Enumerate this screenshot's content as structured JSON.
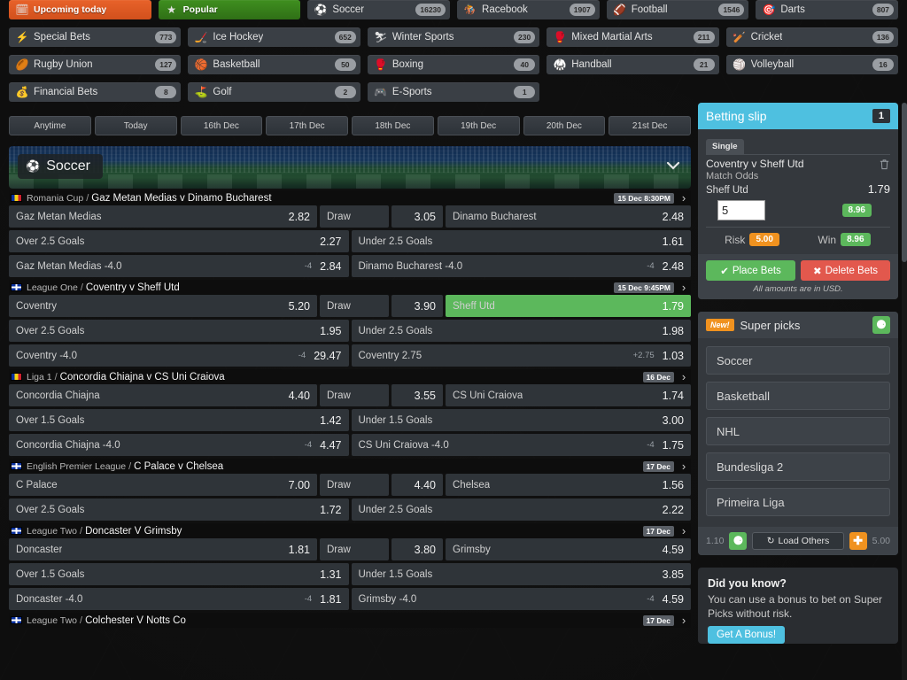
{
  "nav": {
    "tabs": [
      {
        "label": "Upcoming today",
        "icon": "calendar-icon",
        "style": "upcoming"
      },
      {
        "label": "Popular",
        "icon": "star-icon",
        "style": "popular"
      }
    ],
    "sports": [
      {
        "label": "Soccer",
        "count": "16230",
        "icon": "soccer-ball-icon"
      },
      {
        "label": "Racebook",
        "count": "1907",
        "icon": "horse-racing-icon"
      },
      {
        "label": "Football",
        "count": "1546",
        "icon": "american-football-icon"
      },
      {
        "label": "Darts",
        "count": "807",
        "icon": "dart-icon"
      },
      {
        "label": "Special Bets",
        "count": "773",
        "icon": "lightning-icon"
      },
      {
        "label": "Ice Hockey",
        "count": "652",
        "icon": "hockey-puck-icon"
      },
      {
        "label": "Winter Sports",
        "count": "230",
        "icon": "skier-icon"
      },
      {
        "label": "Mixed Martial Arts",
        "count": "211",
        "icon": "mma-glove-icon"
      },
      {
        "label": "Cricket",
        "count": "136",
        "icon": "cricket-bat-icon"
      },
      {
        "label": "Rugby Union",
        "count": "127",
        "icon": "rugby-ball-icon"
      },
      {
        "label": "Basketball",
        "count": "50",
        "icon": "basketball-icon"
      },
      {
        "label": "Boxing",
        "count": "40",
        "icon": "boxing-glove-icon"
      },
      {
        "label": "Handball",
        "count": "21",
        "icon": "handball-icon"
      },
      {
        "label": "Volleyball",
        "count": "16",
        "icon": "volleyball-icon"
      },
      {
        "label": "Financial Bets",
        "count": "8",
        "icon": "money-icon"
      },
      {
        "label": "Golf",
        "count": "2",
        "icon": "golf-icon"
      },
      {
        "label": "E-Sports",
        "count": "1",
        "icon": "gamepad-icon"
      }
    ]
  },
  "date_tabs": [
    "Anytime",
    "Today",
    "16th Dec",
    "17th Dec",
    "18th Dec",
    "19th Dec",
    "20th Dec",
    "21st Dec"
  ],
  "banner": {
    "sport": "Soccer",
    "icon": "soccer-ball-icon",
    "collapse_icon": "chevron-down-icon"
  },
  "matches": [
    {
      "flag": "ro",
      "league": "Romania Cup",
      "title": "Gaz Metan Medias v Dinamo Bucharest",
      "date": "15 Dec 8:30PM",
      "rows": [
        {
          "type": "3way",
          "cells": [
            {
              "name": "Gaz Metan Medias",
              "odds": "2.82"
            },
            {
              "name": "Draw",
              "odds": "3.05"
            },
            {
              "name": "Dinamo Bucharest",
              "odds": "2.48"
            }
          ]
        },
        {
          "type": "2way",
          "cells": [
            {
              "name": "Over 2.5 Goals",
              "odds": "2.27"
            },
            {
              "name": "Under 2.5 Goals",
              "odds": "1.61"
            }
          ]
        },
        {
          "type": "2way",
          "cells": [
            {
              "name": "Gaz Metan Medias -4.0",
              "hcap": "-4",
              "odds": "2.84"
            },
            {
              "name": "Dinamo Bucharest -4.0",
              "hcap": "-4",
              "odds": "2.48"
            }
          ]
        }
      ]
    },
    {
      "flag": "gb",
      "league": "League One",
      "title": "Coventry v Sheff Utd",
      "date": "15 Dec 9:45PM",
      "rows": [
        {
          "type": "3way",
          "cells": [
            {
              "name": "Coventry",
              "odds": "5.20"
            },
            {
              "name": "Draw",
              "odds": "3.90"
            },
            {
              "name": "Sheff Utd",
              "odds": "1.79",
              "selected": true
            }
          ]
        },
        {
          "type": "2way",
          "cells": [
            {
              "name": "Over 2.5 Goals",
              "odds": "1.95"
            },
            {
              "name": "Under 2.5 Goals",
              "odds": "1.98"
            }
          ]
        },
        {
          "type": "2way",
          "cells": [
            {
              "name": "Coventry -4.0",
              "hcap": "-4",
              "odds": "29.47"
            },
            {
              "name": "Coventry 2.75",
              "hcap": "+2.75",
              "odds": "1.03"
            }
          ]
        }
      ]
    },
    {
      "flag": "ro",
      "league": "Liga 1",
      "title": "Concordia Chiajna v CS Uni Craiova",
      "date": "16 Dec",
      "rows": [
        {
          "type": "3way",
          "cells": [
            {
              "name": "Concordia Chiajna",
              "odds": "4.40"
            },
            {
              "name": "Draw",
              "odds": "3.55"
            },
            {
              "name": "CS Uni Craiova",
              "odds": "1.74"
            }
          ]
        },
        {
          "type": "2way",
          "cells": [
            {
              "name": "Over 1.5 Goals",
              "odds": "1.42"
            },
            {
              "name": "Under 1.5 Goals",
              "odds": "3.00"
            }
          ]
        },
        {
          "type": "2way",
          "cells": [
            {
              "name": "Concordia Chiajna -4.0",
              "hcap": "-4",
              "odds": "4.47"
            },
            {
              "name": "CS Uni Craiova -4.0",
              "hcap": "-4",
              "odds": "1.75"
            }
          ]
        }
      ]
    },
    {
      "flag": "gb",
      "league": "English Premier League",
      "title": "C Palace v Chelsea",
      "date": "17 Dec",
      "rows": [
        {
          "type": "3way",
          "cells": [
            {
              "name": "C Palace",
              "odds": "7.00"
            },
            {
              "name": "Draw",
              "odds": "4.40"
            },
            {
              "name": "Chelsea",
              "odds": "1.56"
            }
          ]
        },
        {
          "type": "2way",
          "cells": [
            {
              "name": "Over 2.5 Goals",
              "odds": "1.72"
            },
            {
              "name": "Under 2.5 Goals",
              "odds": "2.22"
            }
          ]
        }
      ]
    },
    {
      "flag": "gb",
      "league": "League Two",
      "title": "Doncaster V Grimsby",
      "date": "17 Dec",
      "rows": [
        {
          "type": "3way",
          "cells": [
            {
              "name": "Doncaster",
              "odds": "1.81"
            },
            {
              "name": "Draw",
              "odds": "3.80"
            },
            {
              "name": "Grimsby",
              "odds": "4.59"
            }
          ]
        },
        {
          "type": "2way",
          "cells": [
            {
              "name": "Over 1.5 Goals",
              "odds": "1.31"
            },
            {
              "name": "Under 1.5 Goals",
              "odds": "3.85"
            }
          ]
        },
        {
          "type": "2way",
          "cells": [
            {
              "name": "Doncaster -4.0",
              "hcap": "-4",
              "odds": "1.81"
            },
            {
              "name": "Grimsby -4.0",
              "hcap": "-4",
              "odds": "4.59"
            }
          ]
        }
      ]
    },
    {
      "flag": "gb",
      "league": "League Two",
      "title": "Colchester V Notts Co",
      "date": "17 Dec",
      "rows": []
    }
  ],
  "betting_slip": {
    "title": "Betting slip",
    "count": "1",
    "mode_tab": "Single",
    "bet": {
      "match": "Coventry v Sheff Utd",
      "market": "Match Odds",
      "selection": "Sheff Utd",
      "odds": "1.79",
      "stake": "5",
      "payout": "8.96",
      "delete_icon": "trash-icon"
    },
    "risk_label": "Risk",
    "risk_value": "5.00",
    "win_label": "Win",
    "win_value": "8.96",
    "place_label": "Place Bets",
    "delete_label": "Delete Bets",
    "place_icon": "check-icon",
    "delete_icon": "cross-icon",
    "currency_note": "All amounts are in USD."
  },
  "super_picks": {
    "badge": "New!",
    "title": "Super picks",
    "collapse_icon": "minus-circle-icon",
    "items": [
      "Soccer",
      "Basketball",
      "NHL",
      "Bundesliga 2",
      "Primeira Liga"
    ],
    "min_odds": "1.10",
    "max_odds": "5.00",
    "decrease_icon": "minus-circle-icon",
    "increase_icon": "plus-circle-icon",
    "load_label": "Load Others",
    "load_icon": "refresh-icon"
  },
  "did_you_know": {
    "heading": "Did you know?",
    "text": "You can use a bonus to bet on Super Picks without risk.",
    "cta": "Get A Bonus!"
  },
  "colors": {
    "accent_cyan": "#4ec0e0",
    "green": "#5cb85c",
    "orange": "#f0921f",
    "red": "#e2584d",
    "panel": "#34383d"
  }
}
